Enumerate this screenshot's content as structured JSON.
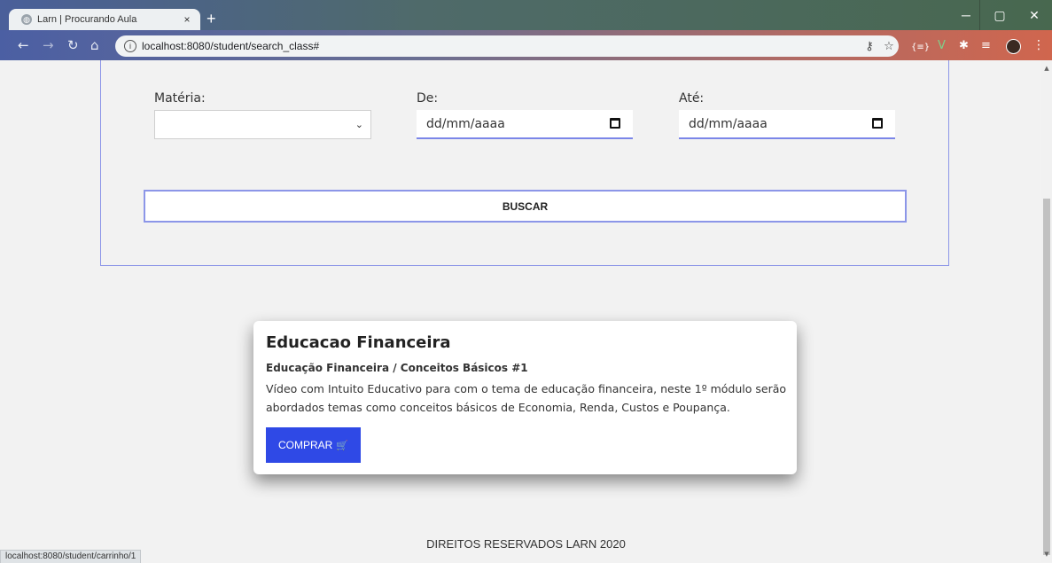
{
  "browser": {
    "tab_title": "Larn | Procurando Aula",
    "tab_close": "×",
    "new_tab": "+",
    "url": "localhost:8080/student/search_class#",
    "status_url": "localhost:8080/student/carrinho/1",
    "window": {
      "minimize": "─",
      "maximize": "▢",
      "close": "✕"
    }
  },
  "search": {
    "materia_label": "Matéria:",
    "de_label": "De:",
    "ate_label": "Até:",
    "date_placeholder_de": "dd/mm/aaaa",
    "date_placeholder_ate": "dd/mm/aaaa",
    "button_label": "BUSCAR"
  },
  "card": {
    "title": "Educacao Financeira",
    "subtitle": "Educação Financeira / Conceitos Básicos #1",
    "description": "Vídeo com Intuito Educativo para com o tema de educação financeira, neste 1º módulo serão abordados temas como conceitos básicos de Economia, Renda, Custos e Poupança.",
    "button_label": "COMPRAR"
  },
  "footer": {
    "text": "DIREITOS RESERVADOS LARN 2020"
  },
  "colors": {
    "accent": "#2f49e6",
    "panel_border": "#8c96e8"
  }
}
